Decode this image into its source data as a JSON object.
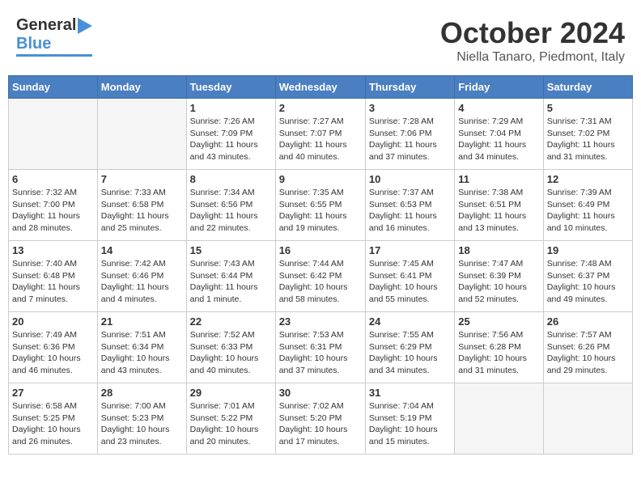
{
  "header": {
    "logo_general": "General",
    "logo_blue": "Blue",
    "month_title": "October 2024",
    "location": "Niella Tanaro, Piedmont, Italy"
  },
  "weekdays": [
    "Sunday",
    "Monday",
    "Tuesday",
    "Wednesday",
    "Thursday",
    "Friday",
    "Saturday"
  ],
  "weeks": [
    [
      {
        "day": "",
        "info": ""
      },
      {
        "day": "",
        "info": ""
      },
      {
        "day": "1",
        "info": "Sunrise: 7:26 AM\nSunset: 7:09 PM\nDaylight: 11 hours\nand 43 minutes."
      },
      {
        "day": "2",
        "info": "Sunrise: 7:27 AM\nSunset: 7:07 PM\nDaylight: 11 hours\nand 40 minutes."
      },
      {
        "day": "3",
        "info": "Sunrise: 7:28 AM\nSunset: 7:06 PM\nDaylight: 11 hours\nand 37 minutes."
      },
      {
        "day": "4",
        "info": "Sunrise: 7:29 AM\nSunset: 7:04 PM\nDaylight: 11 hours\nand 34 minutes."
      },
      {
        "day": "5",
        "info": "Sunrise: 7:31 AM\nSunset: 7:02 PM\nDaylight: 11 hours\nand 31 minutes."
      }
    ],
    [
      {
        "day": "6",
        "info": "Sunrise: 7:32 AM\nSunset: 7:00 PM\nDaylight: 11 hours\nand 28 minutes."
      },
      {
        "day": "7",
        "info": "Sunrise: 7:33 AM\nSunset: 6:58 PM\nDaylight: 11 hours\nand 25 minutes."
      },
      {
        "day": "8",
        "info": "Sunrise: 7:34 AM\nSunset: 6:56 PM\nDaylight: 11 hours\nand 22 minutes."
      },
      {
        "day": "9",
        "info": "Sunrise: 7:35 AM\nSunset: 6:55 PM\nDaylight: 11 hours\nand 19 minutes."
      },
      {
        "day": "10",
        "info": "Sunrise: 7:37 AM\nSunset: 6:53 PM\nDaylight: 11 hours\nand 16 minutes."
      },
      {
        "day": "11",
        "info": "Sunrise: 7:38 AM\nSunset: 6:51 PM\nDaylight: 11 hours\nand 13 minutes."
      },
      {
        "day": "12",
        "info": "Sunrise: 7:39 AM\nSunset: 6:49 PM\nDaylight: 11 hours\nand 10 minutes."
      }
    ],
    [
      {
        "day": "13",
        "info": "Sunrise: 7:40 AM\nSunset: 6:48 PM\nDaylight: 11 hours\nand 7 minutes."
      },
      {
        "day": "14",
        "info": "Sunrise: 7:42 AM\nSunset: 6:46 PM\nDaylight: 11 hours\nand 4 minutes."
      },
      {
        "day": "15",
        "info": "Sunrise: 7:43 AM\nSunset: 6:44 PM\nDaylight: 11 hours\nand 1 minute."
      },
      {
        "day": "16",
        "info": "Sunrise: 7:44 AM\nSunset: 6:42 PM\nDaylight: 10 hours\nand 58 minutes."
      },
      {
        "day": "17",
        "info": "Sunrise: 7:45 AM\nSunset: 6:41 PM\nDaylight: 10 hours\nand 55 minutes."
      },
      {
        "day": "18",
        "info": "Sunrise: 7:47 AM\nSunset: 6:39 PM\nDaylight: 10 hours\nand 52 minutes."
      },
      {
        "day": "19",
        "info": "Sunrise: 7:48 AM\nSunset: 6:37 PM\nDaylight: 10 hours\nand 49 minutes."
      }
    ],
    [
      {
        "day": "20",
        "info": "Sunrise: 7:49 AM\nSunset: 6:36 PM\nDaylight: 10 hours\nand 46 minutes."
      },
      {
        "day": "21",
        "info": "Sunrise: 7:51 AM\nSunset: 6:34 PM\nDaylight: 10 hours\nand 43 minutes."
      },
      {
        "day": "22",
        "info": "Sunrise: 7:52 AM\nSunset: 6:33 PM\nDaylight: 10 hours\nand 40 minutes."
      },
      {
        "day": "23",
        "info": "Sunrise: 7:53 AM\nSunset: 6:31 PM\nDaylight: 10 hours\nand 37 minutes."
      },
      {
        "day": "24",
        "info": "Sunrise: 7:55 AM\nSunset: 6:29 PM\nDaylight: 10 hours\nand 34 minutes."
      },
      {
        "day": "25",
        "info": "Sunrise: 7:56 AM\nSunset: 6:28 PM\nDaylight: 10 hours\nand 31 minutes."
      },
      {
        "day": "26",
        "info": "Sunrise: 7:57 AM\nSunset: 6:26 PM\nDaylight: 10 hours\nand 29 minutes."
      }
    ],
    [
      {
        "day": "27",
        "info": "Sunrise: 6:58 AM\nSunset: 5:25 PM\nDaylight: 10 hours\nand 26 minutes."
      },
      {
        "day": "28",
        "info": "Sunrise: 7:00 AM\nSunset: 5:23 PM\nDaylight: 10 hours\nand 23 minutes."
      },
      {
        "day": "29",
        "info": "Sunrise: 7:01 AM\nSunset: 5:22 PM\nDaylight: 10 hours\nand 20 minutes."
      },
      {
        "day": "30",
        "info": "Sunrise: 7:02 AM\nSunset: 5:20 PM\nDaylight: 10 hours\nand 17 minutes."
      },
      {
        "day": "31",
        "info": "Sunrise: 7:04 AM\nSunset: 5:19 PM\nDaylight: 10 hours\nand 15 minutes."
      },
      {
        "day": "",
        "info": ""
      },
      {
        "day": "",
        "info": ""
      }
    ]
  ]
}
